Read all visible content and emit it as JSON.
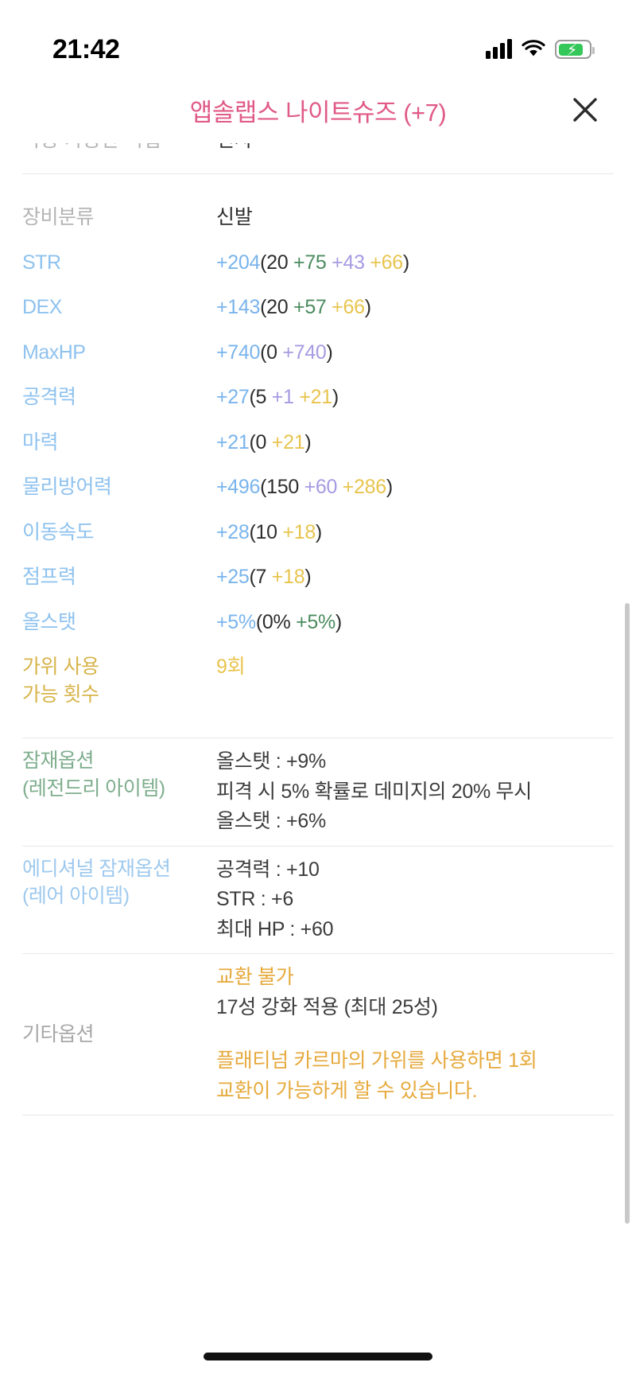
{
  "statusbar": {
    "time": "21:42",
    "signal_icon": "cellular-signal-icon",
    "wifi_icon": "wifi-icon",
    "battery_icon": "battery-charging-icon"
  },
  "header": {
    "title": "앱솔랩스 나이트슈즈 (+7)",
    "close_label": "✕"
  },
  "clipped_row": {
    "label": "착용 가능한 직업",
    "value": "선사"
  },
  "stats": [
    {
      "label": "장비분류",
      "label_color": "lbl-grey",
      "parts": [
        {
          "text": "신발",
          "color": "v-dark"
        }
      ]
    },
    {
      "label": "STR",
      "label_color": "lbl-blue",
      "parts": [
        {
          "text": "+204",
          "color": "v-blue"
        },
        {
          "text": "(",
          "color": "v-dark"
        },
        {
          "text": "20",
          "color": "v-dark"
        },
        {
          "text": " +75",
          "color": "v-green"
        },
        {
          "text": " +43",
          "color": "v-purple"
        },
        {
          "text": " +66",
          "color": "v-gold"
        },
        {
          "text": ")",
          "color": "v-dark"
        }
      ]
    },
    {
      "label": "DEX",
      "label_color": "lbl-blue",
      "parts": [
        {
          "text": "+143",
          "color": "v-blue"
        },
        {
          "text": "(",
          "color": "v-dark"
        },
        {
          "text": "20",
          "color": "v-dark"
        },
        {
          "text": " +57",
          "color": "v-green"
        },
        {
          "text": " +66",
          "color": "v-gold"
        },
        {
          "text": ")",
          "color": "v-dark"
        }
      ]
    },
    {
      "label": "MaxHP",
      "label_color": "lbl-blue",
      "parts": [
        {
          "text": "+740",
          "color": "v-blue"
        },
        {
          "text": "(",
          "color": "v-dark"
        },
        {
          "text": "0",
          "color": "v-dark"
        },
        {
          "text": " +740",
          "color": "v-purple"
        },
        {
          "text": ")",
          "color": "v-dark"
        }
      ]
    },
    {
      "label": "공격력",
      "label_color": "lbl-blue",
      "parts": [
        {
          "text": "+27",
          "color": "v-blue"
        },
        {
          "text": "(",
          "color": "v-dark"
        },
        {
          "text": "5",
          "color": "v-dark"
        },
        {
          "text": " +1",
          "color": "v-purple"
        },
        {
          "text": " +21",
          "color": "v-gold"
        },
        {
          "text": ")",
          "color": "v-dark"
        }
      ]
    },
    {
      "label": "마력",
      "label_color": "lbl-blue",
      "parts": [
        {
          "text": "+21",
          "color": "v-blue"
        },
        {
          "text": "(",
          "color": "v-dark"
        },
        {
          "text": "0",
          "color": "v-dark"
        },
        {
          "text": " +21",
          "color": "v-gold"
        },
        {
          "text": ")",
          "color": "v-dark"
        }
      ]
    },
    {
      "label": "물리방어력",
      "label_color": "lbl-blue",
      "parts": [
        {
          "text": "+496",
          "color": "v-blue"
        },
        {
          "text": "(",
          "color": "v-dark"
        },
        {
          "text": "150",
          "color": "v-dark"
        },
        {
          "text": " +60",
          "color": "v-purple"
        },
        {
          "text": " +286",
          "color": "v-gold"
        },
        {
          "text": ")",
          "color": "v-dark"
        }
      ]
    },
    {
      "label": "이동속도",
      "label_color": "lbl-blue",
      "parts": [
        {
          "text": "+28",
          "color": "v-blue"
        },
        {
          "text": "(",
          "color": "v-dark"
        },
        {
          "text": "10",
          "color": "v-dark"
        },
        {
          "text": " +18",
          "color": "v-gold"
        },
        {
          "text": ")",
          "color": "v-dark"
        }
      ]
    },
    {
      "label": "점프력",
      "label_color": "lbl-blue",
      "parts": [
        {
          "text": "+25",
          "color": "v-blue"
        },
        {
          "text": "(",
          "color": "v-dark"
        },
        {
          "text": "7",
          "color": "v-dark"
        },
        {
          "text": " +18",
          "color": "v-gold"
        },
        {
          "text": ")",
          "color": "v-dark"
        }
      ]
    },
    {
      "label": "올스탯",
      "label_color": "lbl-blue",
      "parts": [
        {
          "text": "+5%",
          "color": "v-blue"
        },
        {
          "text": "(",
          "color": "v-dark"
        },
        {
          "text": "0%",
          "color": "v-dark"
        },
        {
          "text": " +5%",
          "color": "v-green"
        },
        {
          "text": ")",
          "color": "v-dark"
        }
      ]
    },
    {
      "label": "가위 사용\n가능 횟수",
      "label_color": "lbl-gold",
      "parts": [
        {
          "text": "9회",
          "color": "v-gold"
        }
      ]
    }
  ],
  "potential": {
    "label": "잠재옵션\n(레전드리 아이템)",
    "lines": [
      "올스탯 : +9%",
      "피격 시 5% 확률로 데미지의 20% 무시",
      "올스탯 : +6%"
    ]
  },
  "additional_potential": {
    "label": "에디셔널 잠재옵션\n(레어 아이템)",
    "lines": [
      "공격력 : +10",
      "STR : +6",
      "최대 HP : +60"
    ]
  },
  "other_options": {
    "label": "기타옵션",
    "trade_status": "교환 불가",
    "star_force": "17성 강화 적용 (최대 25성)",
    "scissors_note": "플래티넘 카르마의 가위를 사용하면 1회\n교환이 가능하게 할 수 있습니다."
  },
  "colors": {
    "title_pink": "#e05a86",
    "stat_label_blue": "#8ec2ef",
    "total_blue": "#79b4ec",
    "base_dark": "#2e2e2e",
    "green": "#4b8b5e",
    "purple": "#a79ae2",
    "gold": "#e8c44e",
    "orange": "#e6a93c",
    "grey_label": "#b4b4b4"
  }
}
